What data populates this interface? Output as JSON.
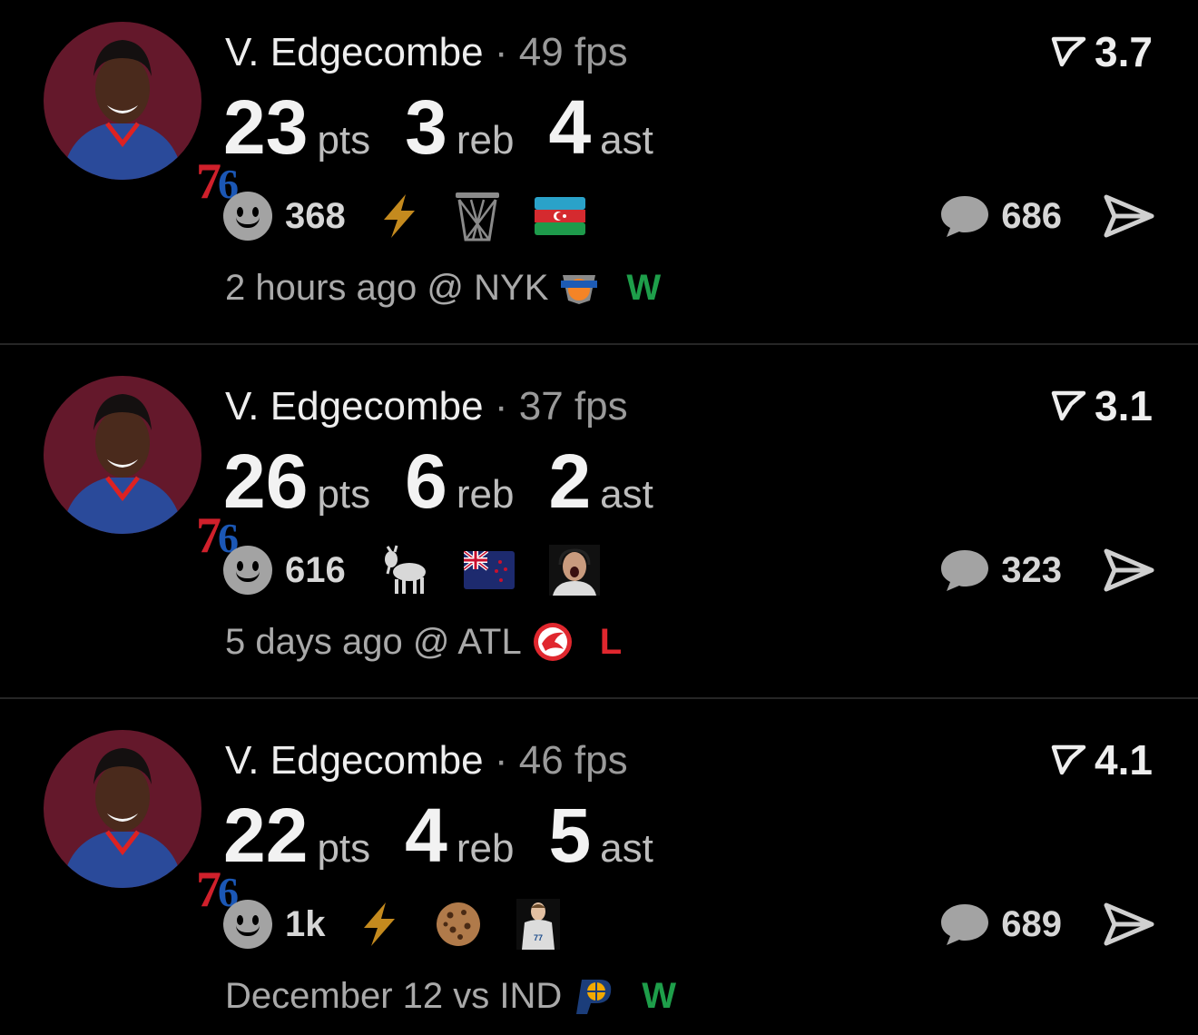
{
  "colors": {
    "win": "#1e9e4a",
    "loss": "#e0272e",
    "avatar_bg": "#64182b"
  },
  "feed": [
    {
      "player": "V. Edgecombe",
      "fps": "49 fps",
      "rating": "3.7",
      "points": "23",
      "pts_label": "pts",
      "rebounds": "3",
      "reb_label": "reb",
      "assists": "4",
      "ast_label": "ast",
      "reaction_count": "368",
      "badges": [
        "lightning-icon",
        "basketball-hoop-icon",
        "azerbaijan-flag-icon"
      ],
      "comment_count": "686",
      "time": "2 hours ago",
      "venue": "@ NYK",
      "team_logo": "knicks-logo",
      "result": "W"
    },
    {
      "player": "V. Edgecombe",
      "fps": "37 fps",
      "rating": "3.1",
      "points": "26",
      "pts_label": "pts",
      "rebounds": "6",
      "reb_label": "reb",
      "assists": "2",
      "ast_label": "ast",
      "reaction_count": "616",
      "badges": [
        "goat-icon",
        "new-zealand-flag-icon",
        "announcer-photo"
      ],
      "comment_count": "323",
      "time": "5 days ago",
      "venue": "@ ATL",
      "team_logo": "hawks-logo",
      "result": "L"
    },
    {
      "player": "V. Edgecombe",
      "fps": "46 fps",
      "rating": "4.1",
      "points": "22",
      "pts_label": "pts",
      "rebounds": "4",
      "reb_label": "reb",
      "assists": "5",
      "ast_label": "ast",
      "reaction_count": "1k",
      "badges": [
        "lightning-icon",
        "cookie-icon",
        "mavericks-player-photo"
      ],
      "comment_count": "689",
      "time": "December 12",
      "venue": "vs IND",
      "team_logo": "pacers-logo",
      "result": "W"
    }
  ]
}
